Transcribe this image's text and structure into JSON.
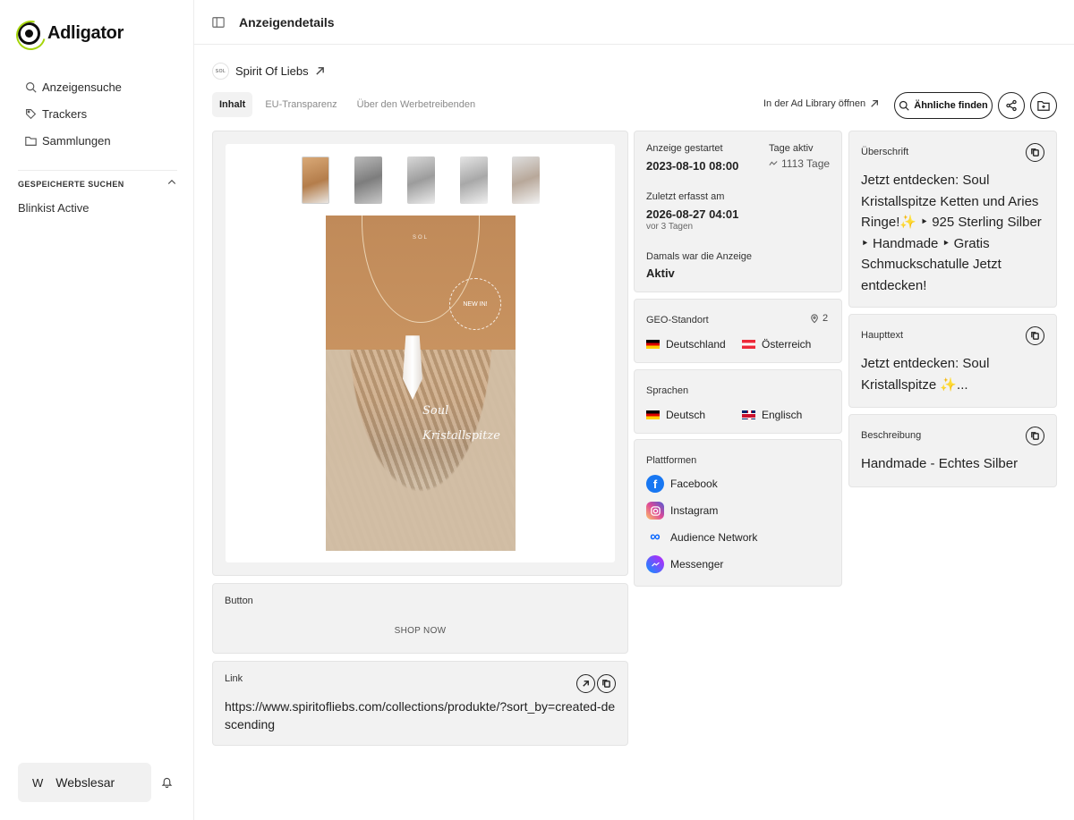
{
  "app": {
    "name": "Adligator"
  },
  "sidebar": {
    "nav": [
      {
        "label": "Anzeigensuche",
        "icon": "search-icon"
      },
      {
        "label": "Trackers",
        "icon": "tag-icon"
      },
      {
        "label": "Sammlungen",
        "icon": "folder-icon"
      }
    ],
    "saved_title": "GESPEICHERTE SUCHEN",
    "saved_items": [
      "Blinkist Active"
    ],
    "user": {
      "initial": "W",
      "name": "Webslesar"
    }
  },
  "header": {
    "title": "Anzeigendetails"
  },
  "advertiser": {
    "avatar_text": "SOL",
    "name": "Spirit Of Liebs"
  },
  "tabs": [
    {
      "label": "Inhalt",
      "active": true
    },
    {
      "label": "EU-Transparenz",
      "active": false
    },
    {
      "label": "Über den Werbetreibenden",
      "active": false
    }
  ],
  "toolbar": {
    "open_library": "In der Ad Library öffnen",
    "similar": "Ähnliche finden"
  },
  "media": {
    "hero_brand": "SOL",
    "hero_badge": "NEW IN!",
    "hero_script": "Soul Kristallspitze"
  },
  "button_card": {
    "label": "Button",
    "cta": "SHOP NOW"
  },
  "link_card": {
    "label": "Link",
    "url": "https://www.spiritofliebs.com/collections/produkte/?sort_by=created-descending"
  },
  "info": {
    "started_label": "Anzeige gestartet",
    "started_value": "2023-08-10 08:00",
    "days_label": "Tage aktiv",
    "days_value": "1113 Tage",
    "last_seen_label": "Zuletzt erfasst am",
    "last_seen_value": "2026-08-27 04:01",
    "last_seen_sub": "vor 3 Tagen",
    "status_label": "Damals war die Anzeige",
    "status_value": "Aktiv"
  },
  "geo": {
    "label": "GEO-Standort",
    "count": "2",
    "countries": [
      "Deutschland",
      "Österreich"
    ]
  },
  "languages": {
    "label": "Sprachen",
    "items": [
      "Deutsch",
      "Englisch"
    ]
  },
  "platforms": {
    "label": "Plattformen",
    "items": [
      "Facebook",
      "Instagram",
      "Audience Network",
      "Messenger"
    ]
  },
  "headline": {
    "label": "Überschrift",
    "text": "Jetzt entdecken: Soul Kristallspitze Ketten und Aries Ringe!✨ ‣ 925 Sterling Silber ‣ Handmade ‣ Gratis Schmuckschatulle Jetzt entdecken!"
  },
  "main_text": {
    "label": "Haupttext",
    "text": "Jetzt entdecken: Soul Kristallspitze ✨..."
  },
  "description": {
    "label": "Beschreibung",
    "text": "Handmade - Echtes Silber"
  }
}
